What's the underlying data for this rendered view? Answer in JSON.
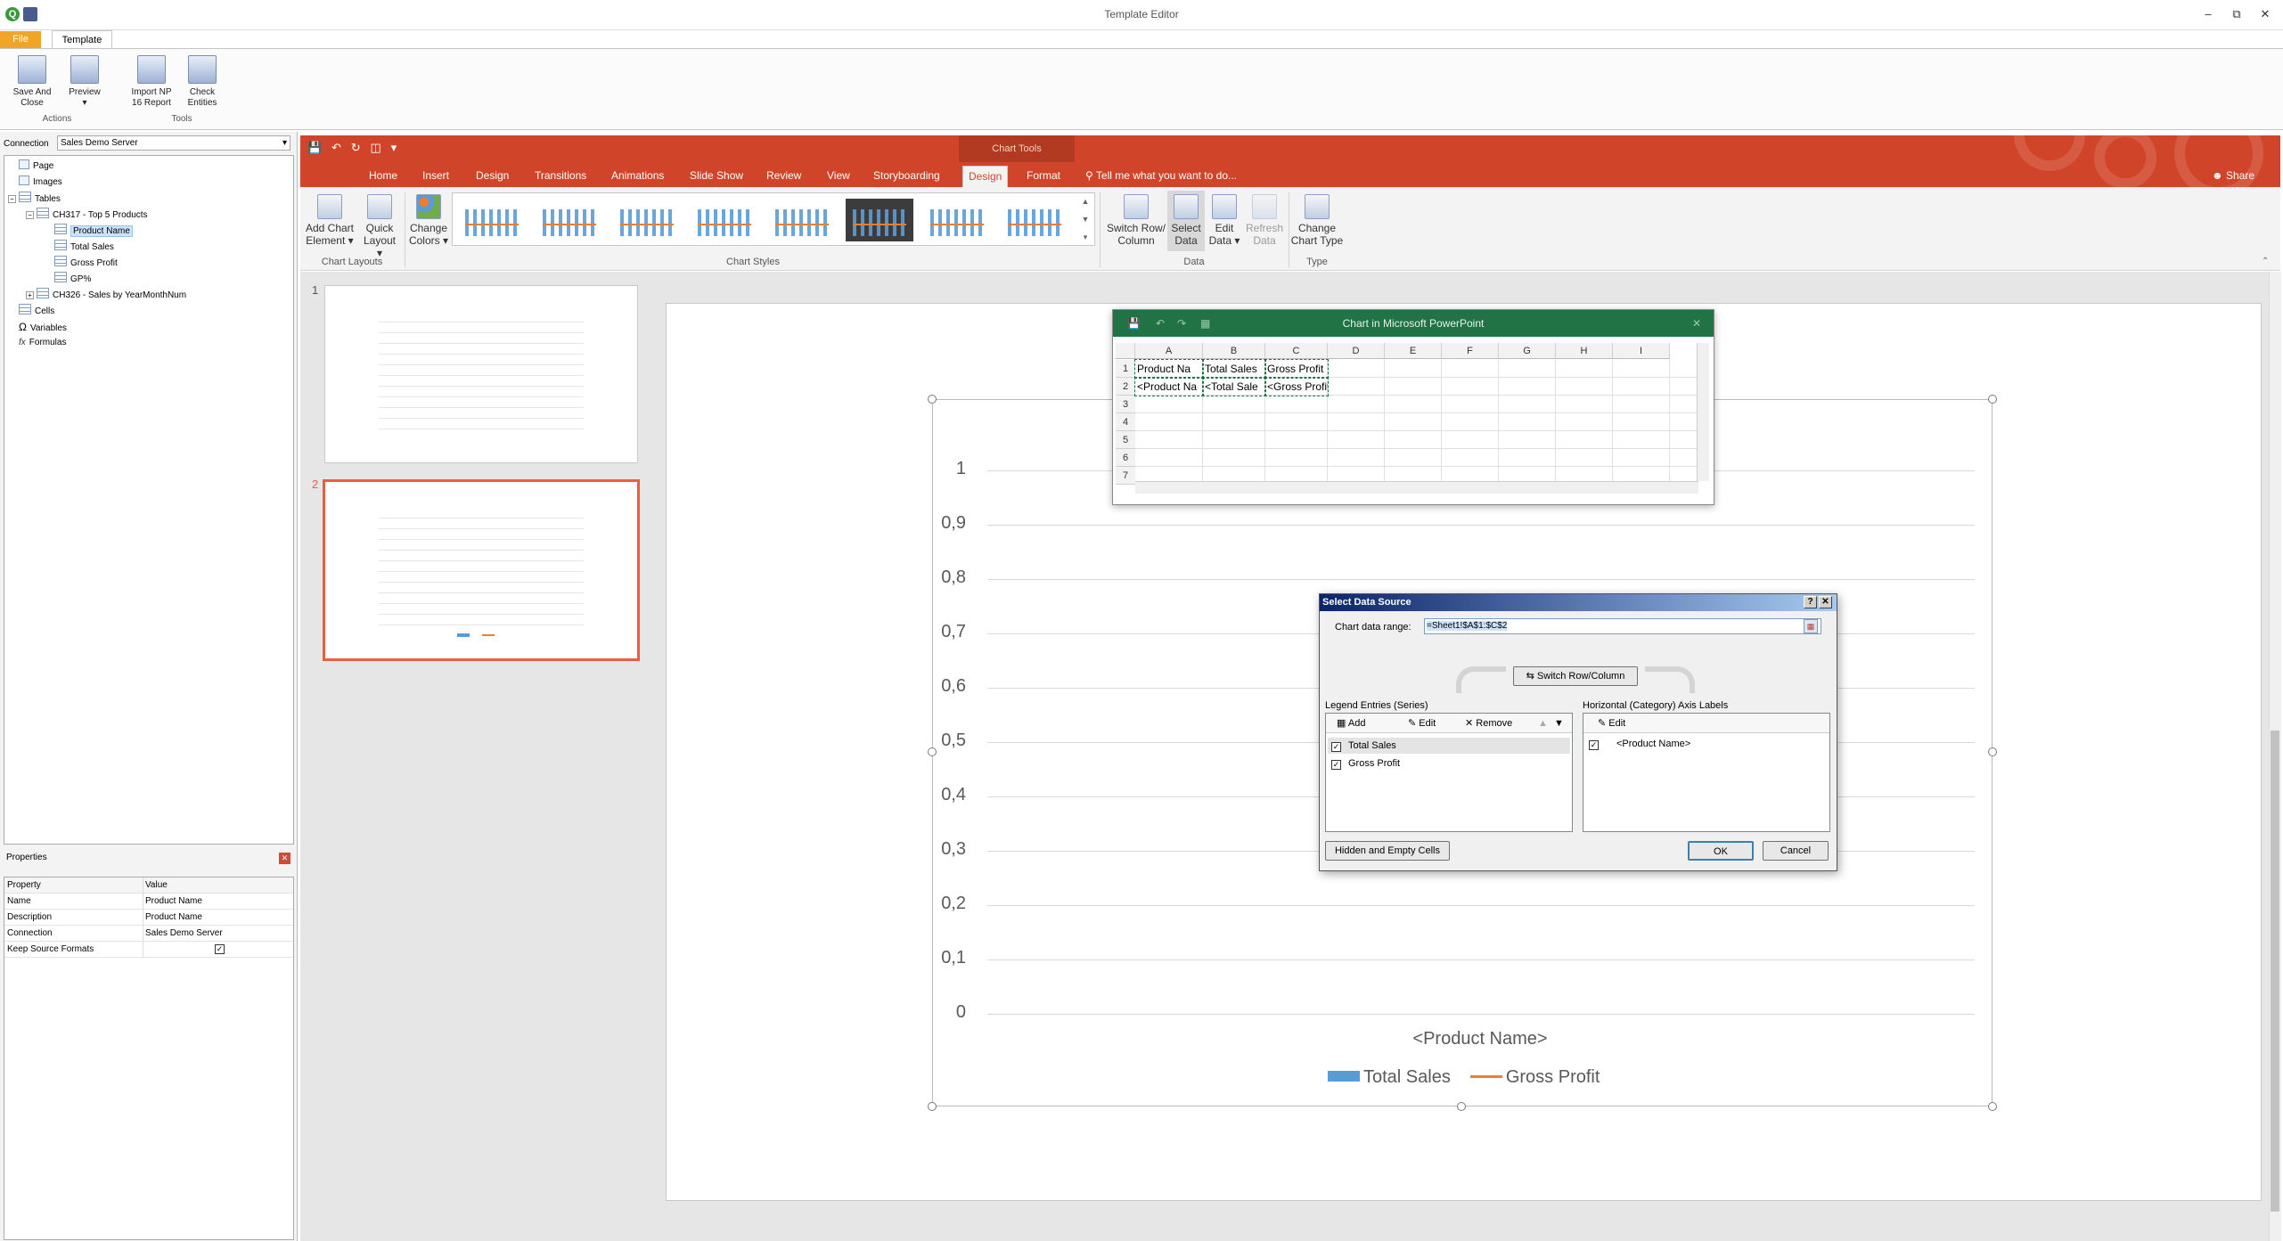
{
  "window": {
    "title": "Template Editor"
  },
  "outer": {
    "file_tab": "File",
    "template_tab": "Template",
    "buttons": {
      "save_and_close": [
        "Save And",
        "Close"
      ],
      "preview": "Preview",
      "import": [
        "Import NP",
        "16 Report"
      ],
      "check": [
        "Check",
        "Entities"
      ]
    },
    "groups": {
      "actions": "Actions",
      "tools": "Tools"
    }
  },
  "left": {
    "connection_label": "Connection",
    "connection_value": "Sales Demo Server",
    "tree": {
      "page": "Page",
      "images": "Images",
      "tables": "Tables",
      "ch317": "CH317 - Top 5 Products",
      "product_name": "Product Name",
      "total_sales": "Total Sales",
      "gross_profit": "Gross Profit",
      "gp_pct": "GP%",
      "ch326": "CH326 - Sales by YearMonthNum",
      "cells": "Cells",
      "variables": "Variables",
      "formulas": "Formulas"
    },
    "properties": {
      "title": "Properties",
      "col_property": "Property",
      "col_value": "Value",
      "rows": [
        {
          "k": "Name",
          "v": "Product Name"
        },
        {
          "k": "Description",
          "v": "Product Name"
        },
        {
          "k": "Connection",
          "v": "Sales Demo Server"
        },
        {
          "k": "Keep Source Formats",
          "v": "✓"
        }
      ]
    }
  },
  "ppt": {
    "chart_tools": "Chart Tools",
    "tabs": [
      "Home",
      "Insert",
      "Design",
      "Transitions",
      "Animations",
      "Slide Show",
      "Review",
      "View",
      "Storyboarding",
      "Design",
      "Format"
    ],
    "tell_me": "Tell me what you want to do...",
    "share": "Share",
    "ribbon": {
      "add_chart_element": [
        "Add Chart",
        "Element ▾"
      ],
      "quick_layout": [
        "Quick",
        "Layout ▾"
      ],
      "change_colors": [
        "Change",
        "Colors ▾"
      ],
      "switch_row_col": [
        "Switch Row/",
        "Column"
      ],
      "select_data": [
        "Select",
        "Data"
      ],
      "edit_data": [
        "Edit",
        "Data ▾"
      ],
      "refresh_data": [
        "Refresh",
        "Data"
      ],
      "change_chart_type": [
        "Change",
        "Chart Type"
      ],
      "groups": {
        "chart_layouts": "Chart Layouts",
        "chart_styles": "Chart Styles",
        "data": "Data",
        "type": "Type"
      }
    },
    "slides": [
      "1",
      "2"
    ]
  },
  "excel": {
    "title": "Chart in Microsoft PowerPoint",
    "columns": [
      "A",
      "B",
      "C",
      "D",
      "E",
      "F",
      "G",
      "H",
      "I"
    ],
    "rows": [
      "1",
      "2",
      "3",
      "4",
      "5",
      "6",
      "7"
    ],
    "cells": {
      "A1": "Product Na",
      "B1": "Total Sales",
      "C1": "Gross Profit",
      "A2": "<Product Na",
      "B2": "<Total Sale",
      "C2": "<Gross Profit>"
    }
  },
  "dialog": {
    "title": "Select Data Source",
    "help": "?",
    "close": "✕",
    "range_label": "Chart data range:",
    "range_value": "=Sheet1!$A$1:$C$2",
    "switch_btn": "Switch Row/Column",
    "legend_label": "Legend Entries (Series)",
    "axis_label": "Horizontal (Category) Axis Labels",
    "add": "Add",
    "edit": "Edit",
    "remove": "Remove",
    "series": [
      "Total Sales",
      "Gross Profit"
    ],
    "categories": [
      "<Product Name>"
    ],
    "hidden_btn": "Hidden and Empty Cells",
    "ok": "OK",
    "cancel": "Cancel"
  },
  "chart_data": {
    "type": "bar",
    "categories": [
      "<Product Name>"
    ],
    "series": [
      {
        "name": "Total Sales",
        "values": [
          0
        ],
        "color": "#5b9bd5",
        "kind": "bar"
      },
      {
        "name": "Gross Profit",
        "values": [
          0
        ],
        "color": "#ed7d31",
        "kind": "line"
      }
    ],
    "yticks": [
      "0",
      "0,1",
      "0,2",
      "0,3",
      "0,4",
      "0,5",
      "0,6",
      "0,7",
      "0,8",
      "0,9",
      "1"
    ],
    "ylim": [
      0,
      1
    ],
    "legend": "bottom",
    "grid": true
  }
}
